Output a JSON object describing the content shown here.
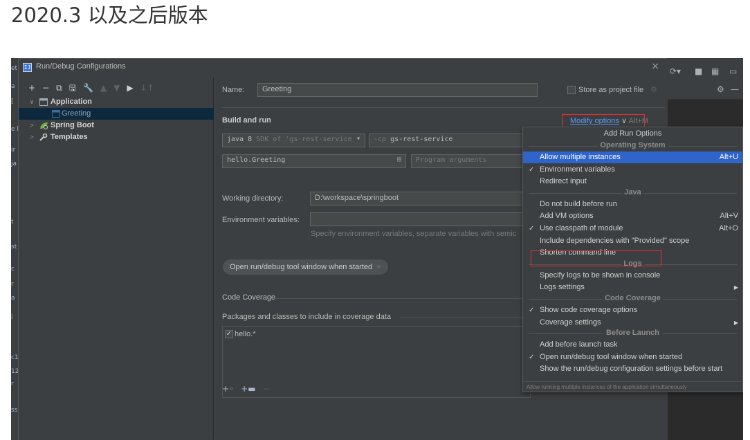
{
  "page_heading": "2020.3 以及之后版本",
  "ide_left_fragments": [
    "et",
    "a",
    "[",
    "e l",
    "ir",
    "ja",
    "t",
    "st",
    "c",
    "r",
    "a",
    "i",
    "c1",
    "12",
    "r",
    "ss"
  ],
  "dialog": {
    "title": "Run/Debug Configurations",
    "close": "×",
    "toolbar": [
      "+",
      "−",
      "⧉",
      "🖫",
      "🔧",
      "▲",
      "▼",
      "▶",
      "↓↑"
    ],
    "tree": [
      {
        "arrow": "∨",
        "label": "Application"
      },
      {
        "arrow": "",
        "label": "Greeting"
      },
      {
        "arrow": ">",
        "label": "Spring Boot"
      },
      {
        "arrow": ">",
        "label": "Templates"
      }
    ]
  },
  "config": {
    "name_label": "Name:",
    "name_value": "Greeting",
    "store_label": "Store as project file",
    "build_run_label": "Build and run",
    "modify_options_label": "Modify options",
    "modify_options_shortcut": "Alt+M",
    "jdk_value": "java 8",
    "jdk_hint": "SDK of 'gs-rest-service",
    "cp_flag": "-cp",
    "cp_value": "gs-rest-service",
    "main_class_value": "hello.Greeting",
    "program_args_placeholder": "Program arguments",
    "working_dir_label": "Working directory:",
    "working_dir_value": "D:\\workspace\\springboot",
    "env_vars_label": "Environment variables:",
    "env_vars_hint": "Specify environment variables, separate variables with semic",
    "chip_label": "Open run/debug tool window when started",
    "code_coverage_label": "Code Coverage",
    "packages_label": "Packages and classes to include in coverage data",
    "coverage_item": "hello.*"
  },
  "popup": {
    "title": "Add Run Options",
    "sections": [
      {
        "title": "Operating System",
        "items": [
          {
            "label": "Allow multiple instances",
            "checked": false,
            "shortcut": "Alt+U",
            "selected": true,
            "submenu": false
          },
          {
            "label": "Environment variables",
            "checked": true,
            "shortcut": "",
            "selected": false,
            "submenu": false
          },
          {
            "label": "Redirect input",
            "checked": false,
            "shortcut": "",
            "selected": false,
            "submenu": false
          }
        ]
      },
      {
        "title": "Java",
        "items": [
          {
            "label": "Do not build before run",
            "checked": false,
            "shortcut": "",
            "selected": false,
            "submenu": false
          },
          {
            "label": "Add VM options",
            "checked": false,
            "shortcut": "Alt+V",
            "selected": false,
            "submenu": false
          },
          {
            "label": "Use classpath of module",
            "checked": true,
            "shortcut": "Alt+O",
            "selected": false,
            "submenu": false
          },
          {
            "label": "Include dependencies with \"Provided\" scope",
            "checked": false,
            "shortcut": "",
            "selected": false,
            "submenu": false
          },
          {
            "label": "Shorten command line",
            "checked": false,
            "shortcut": "",
            "selected": false,
            "submenu": false
          }
        ]
      },
      {
        "title": "Logs",
        "items": [
          {
            "label": "Specify logs to be shown in console",
            "checked": false,
            "shortcut": "",
            "selected": false,
            "submenu": false
          },
          {
            "label": "Logs settings",
            "checked": false,
            "shortcut": "",
            "selected": false,
            "submenu": true
          }
        ]
      },
      {
        "title": "Code Coverage",
        "items": [
          {
            "label": "Show code coverage options",
            "checked": true,
            "shortcut": "",
            "selected": false,
            "submenu": false
          },
          {
            "label": "Coverage settings",
            "checked": false,
            "shortcut": "",
            "selected": false,
            "submenu": true
          }
        ]
      },
      {
        "title": "Before Launch",
        "items": [
          {
            "label": "Add before launch task",
            "checked": false,
            "shortcut": "",
            "selected": false,
            "submenu": false
          },
          {
            "label": "Open run/debug tool window when started",
            "checked": true,
            "shortcut": "",
            "selected": false,
            "submenu": false
          },
          {
            "label": "Show the run/debug configuration settings before start",
            "checked": false,
            "shortcut": "",
            "selected": false,
            "submenu": false
          }
        ]
      }
    ],
    "footer": "Allow running multiple instances of the application simultaneously"
  },
  "colors": {
    "highlight_box": "#e0322e",
    "link": "#589df6",
    "selection": "#2f65ca"
  }
}
